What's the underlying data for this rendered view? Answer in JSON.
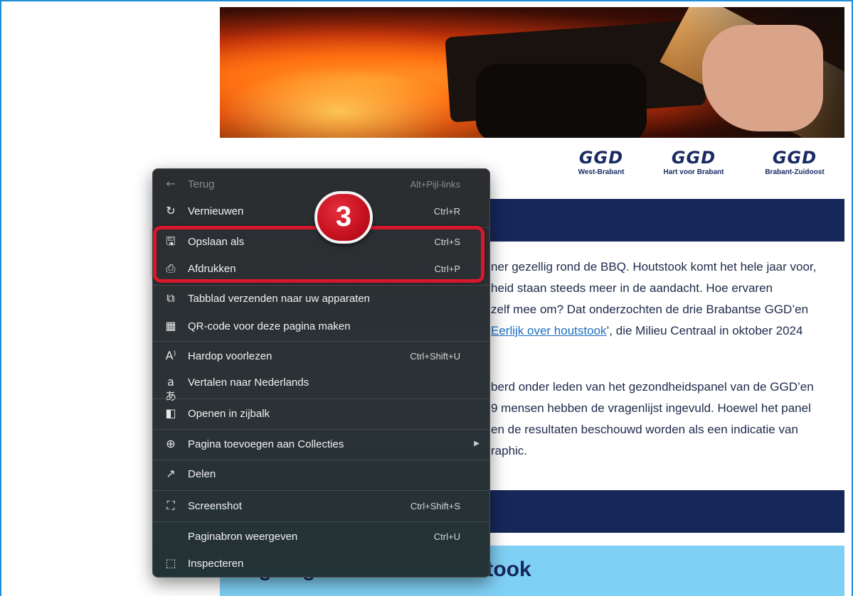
{
  "logos": [
    {
      "mark": "GGD",
      "sub": "West-Brabant"
    },
    {
      "mark": "GGD",
      "sub": "Hart voor Brabant"
    },
    {
      "mark": "GGD",
      "sub": "Brabant-Zuidoost"
    }
  ],
  "article": {
    "lines": [
      "ner gezellig rond de BBQ. Houtstook komt het hele jaar voor,",
      "heid staan steeds meer in de aandacht. Hoe ervaren",
      "zelf mee om? Dat onderzochten de drie Brabantse GGD’en"
    ],
    "link_text": "Eerlijk over houtstook",
    "link_suffix": "’, die Milieu Centraal in oktober 2024",
    "lines2": [
      "berd onder leden van het gezondheidspanel van de GGD’en",
      "9 mensen hebben de vragenlijst ingevuld. Hoewel het panel",
      "en de resultaten beschouwd worden als een indicatie van",
      "raphic."
    ],
    "section_title": "Eigen gebruik van houtstook"
  },
  "context_menu": {
    "items": [
      {
        "icon": "back-arrow-icon",
        "glyph": "←",
        "label": "Terug",
        "shortcut": "Alt+Pijl-links",
        "disabled": true
      },
      {
        "icon": "refresh-icon",
        "glyph": "↻",
        "label": "Vernieuwen",
        "shortcut": "Ctrl+R"
      },
      {
        "icon": "save-as-icon",
        "glyph": "🖫",
        "label": "Opslaan als",
        "shortcut": "Ctrl+S"
      },
      {
        "icon": "print-icon",
        "glyph": "⎙",
        "label": "Afdrukken",
        "shortcut": "Ctrl+P"
      },
      {
        "icon": "send-to-devices-icon",
        "glyph": "⧉",
        "label": "Tabblad verzenden naar uw apparaten",
        "shortcut": ""
      },
      {
        "icon": "qr-code-icon",
        "glyph": "▦",
        "label": "QR-code voor deze pagina maken",
        "shortcut": ""
      },
      {
        "icon": "read-aloud-icon",
        "glyph": "A⁾",
        "label": "Hardop voorlezen",
        "shortcut": "Ctrl+Shift+U"
      },
      {
        "icon": "translate-icon",
        "glyph": "aあ",
        "label": "Vertalen naar Nederlands",
        "shortcut": ""
      },
      {
        "icon": "sidebar-icon",
        "glyph": "◧",
        "label": "Openen in zijbalk",
        "shortcut": ""
      },
      {
        "icon": "collections-icon",
        "glyph": "⊕",
        "label": "Pagina toevoegen aan Collecties",
        "shortcut": "",
        "submenu": true
      },
      {
        "icon": "share-icon",
        "glyph": "↗",
        "label": "Delen",
        "shortcut": ""
      },
      {
        "icon": "screenshot-icon",
        "glyph": "⛶",
        "label": "Screenshot",
        "shortcut": "Ctrl+Shift+S"
      },
      {
        "icon": "",
        "glyph": "",
        "label": "Paginabron weergeven",
        "shortcut": "Ctrl+U"
      },
      {
        "icon": "inspect-icon",
        "glyph": "⬚",
        "label": "Inspecteren",
        "shortcut": ""
      }
    ]
  },
  "annotation": {
    "step_number": "3"
  },
  "colors": {
    "navy": "#16275a",
    "light_blue": "#7fd0f5",
    "highlight_red": "#d8182a",
    "menu_bg": "#2b2d30",
    "link": "#1e6fc2"
  }
}
